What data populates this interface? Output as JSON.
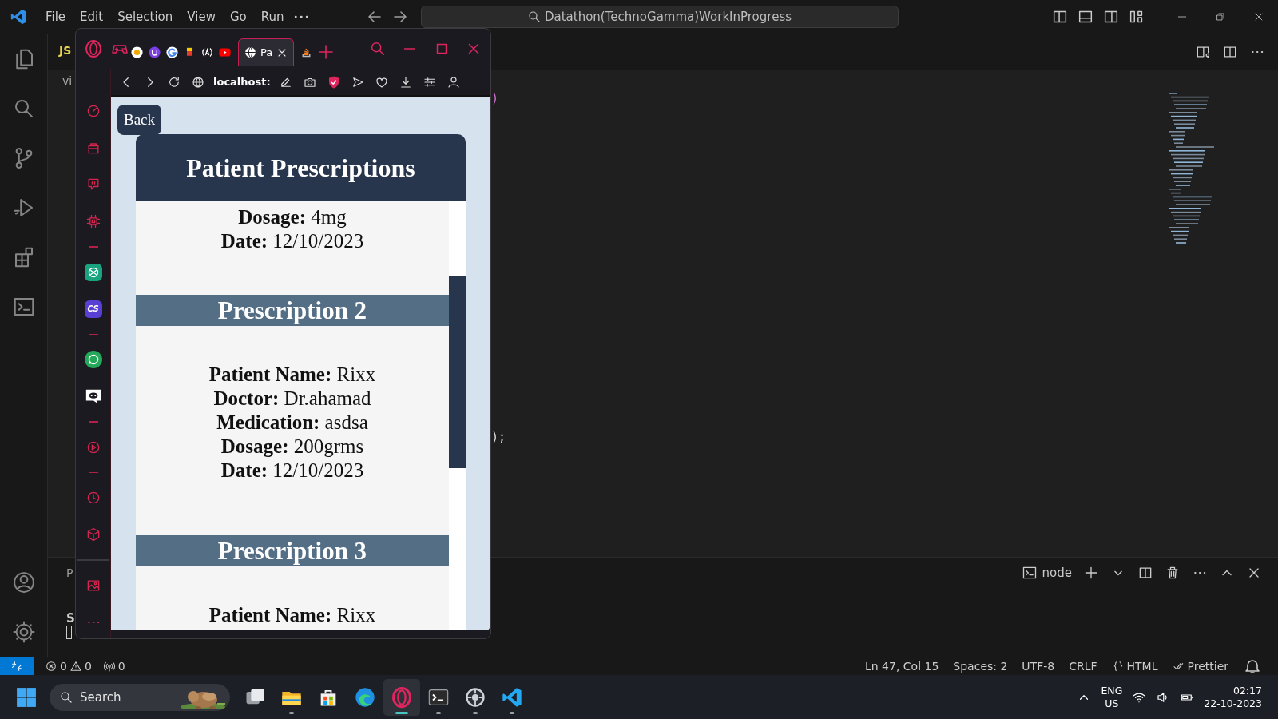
{
  "vscode": {
    "menu": [
      "File",
      "Edit",
      "Selection",
      "View",
      "Go",
      "Run"
    ],
    "command_center": "Datathon(TechnoGamma)WorkInProgress",
    "editor": {
      "tab_label": "JS",
      "breadcrumb": "vi",
      "code_fragments": [
        ")",
        ");"
      ]
    },
    "panel": {
      "tab_fragment": "P",
      "output_fragment": "S",
      "terminal_name": "node"
    },
    "status_bar": {
      "errors": "0",
      "warnings": "0",
      "ports": "0",
      "position": "Ln 47, Col 15",
      "indentation": "Spaces: 2",
      "encoding": "UTF-8",
      "line_ending": "CRLF",
      "language": "HTML",
      "formatter": "Prettier"
    }
  },
  "browser": {
    "tabs": [
      {
        "selected": false
      },
      {
        "selected": false
      },
      {
        "selected": false
      },
      {
        "selected": false
      },
      {
        "selected": false
      },
      {
        "selected": false
      },
      {
        "label": "Pa",
        "selected": true
      },
      {
        "selected": false
      }
    ],
    "sidebar_app_label": "CS",
    "address": "localhost:",
    "page": {
      "back_button": "Back",
      "title": "Patient Prescriptions",
      "sections": [
        {
          "lines": [
            "**Dosage:** 4mg",
            "**Date:** 12/10/2023"
          ]
        },
        {
          "heading": "Prescription 2",
          "lines": [
            "**Patient Name:** Rixx",
            "**Doctor:** Dr.ahamad",
            "**Medication:** asdsa",
            "**Dosage:** 200grms",
            "**Date:** 12/10/2023"
          ]
        },
        {
          "heading": "Prescription 3",
          "lines": [
            "**Patient Name:** Rixx"
          ]
        }
      ]
    }
  },
  "taskbar": {
    "search_label": "Search",
    "apps": [
      {
        "running": false,
        "selected": false
      },
      {
        "running": true,
        "selected": false
      },
      {
        "running": false,
        "selected": false
      },
      {
        "running": false,
        "selected": false
      },
      {
        "running": true,
        "selected": true
      },
      {
        "running": true,
        "selected": false
      },
      {
        "running": true,
        "selected": false
      },
      {
        "running": true,
        "selected": false
      }
    ],
    "language": "ENG",
    "region": "US",
    "time": "02:17",
    "date": "22-10-2023"
  }
}
